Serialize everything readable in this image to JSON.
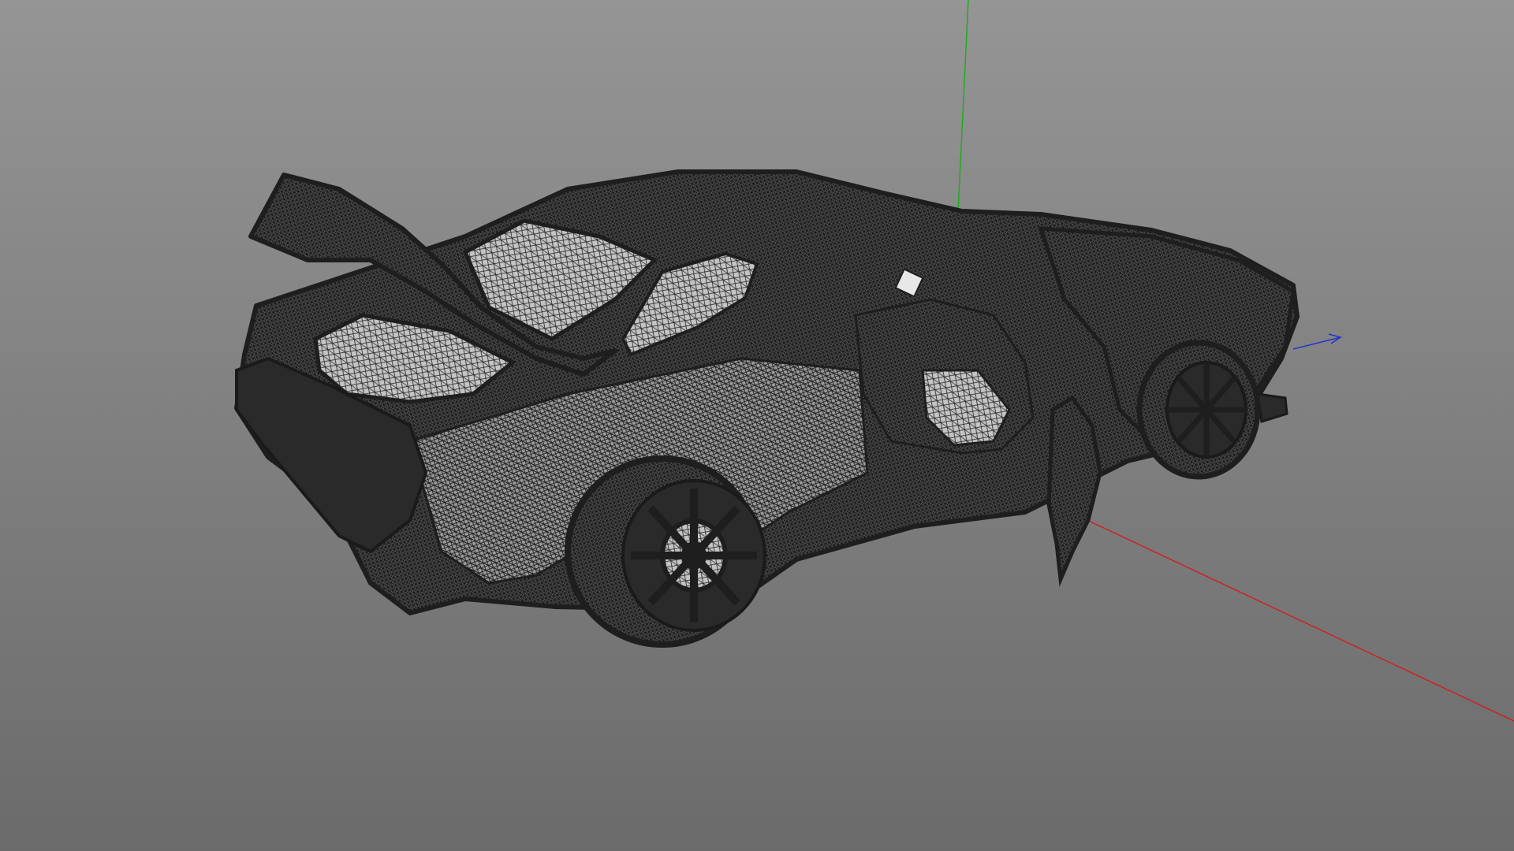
{
  "viewport": {
    "background_top": "#959595",
    "background_bottom": "#6b6b6b"
  },
  "axes": {
    "x_color": "#cc2222",
    "y_color": "#22aa22",
    "z_color": "#2233cc"
  },
  "model": {
    "display_mode": "wireframe",
    "mesh_color": "#1e1e1e",
    "icon": "car-wireframe-icon"
  }
}
